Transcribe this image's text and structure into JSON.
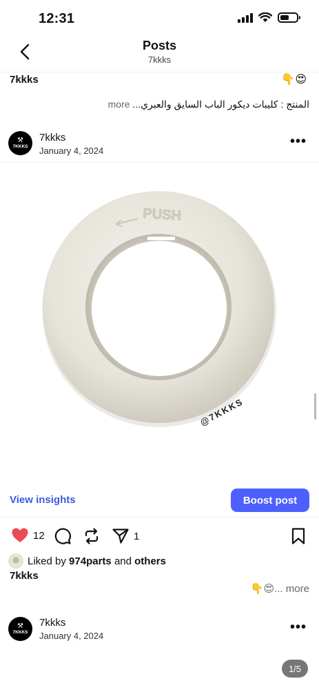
{
  "status_bar": {
    "time": "12:31"
  },
  "header": {
    "title": "Posts",
    "subtitle": "7kkks"
  },
  "previous_post": {
    "username": "7kkks",
    "emoji": "👇😍",
    "caption": "المنتج : كليبات ديكور الباب السايق والعبري...",
    "more_label": "more"
  },
  "post": {
    "username": "7kkks",
    "date": "January 4, 2024",
    "avatar_text": "7KKKS",
    "image": {
      "ring_top_text": "PUSH",
      "watermark": "@7KKKS"
    },
    "view_insights": "View insights",
    "boost_label": "Boost post",
    "likes_count": "12",
    "shares_count": "1",
    "liked_by_prefix": "Liked by",
    "liked_by_user": "974parts",
    "liked_by_and": "and",
    "liked_by_others": "others",
    "caption_user": "7kkks",
    "caption_tail": "👇😍... more"
  },
  "next_post": {
    "username": "7kkks",
    "date": "January 4, 2024",
    "avatar_text": "7KKKS"
  },
  "page_indicator": "1/5",
  "colors": {
    "accent": "#4d5fff",
    "link": "#3b5bdb",
    "like": "#ed4956"
  }
}
